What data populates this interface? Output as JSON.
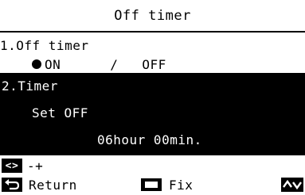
{
  "header": {
    "title": "Off timer"
  },
  "item1": {
    "label": "1.Off timer",
    "option_on": "ON",
    "separator": "/",
    "option_off": "OFF",
    "selected": "ON"
  },
  "item2": {
    "label": "2.Timer",
    "sub_label": "Set OFF",
    "value": "06hour 00min."
  },
  "legend": {
    "adjust_keys": "<>",
    "adjust_label": "-+",
    "return_label": "Return",
    "fix_label": "Fix",
    "nav_keys": "^v"
  }
}
